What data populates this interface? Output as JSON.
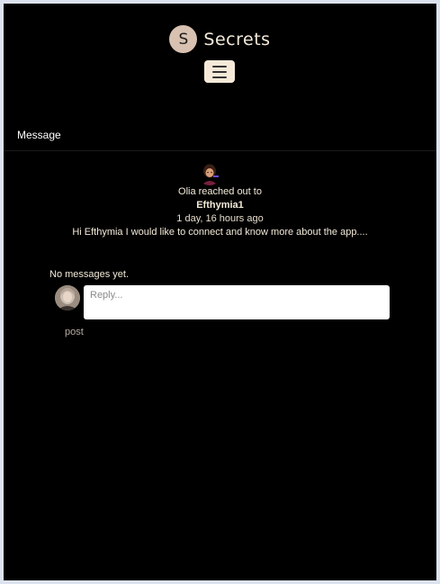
{
  "brand": {
    "logo_letter": "S",
    "name": "Secrets"
  },
  "header": {
    "menu_icon": "hamburger-icon"
  },
  "page": {
    "section_title": "Message"
  },
  "message": {
    "sender_avatar_icon": "user-avatar",
    "reached_out_text": "Olia reached out to",
    "recipient": "Efthymia1",
    "timestamp": "1 day, 16 hours ago",
    "body": "Hi Efthymia I would like to connect and know more about the app...."
  },
  "replies": {
    "empty_text": "No messages yet.",
    "input_placeholder": "Reply...",
    "post_label": "post",
    "avatar_icon": "user-avatar"
  },
  "colors": {
    "background": "#000000",
    "frame": "#dde3ee",
    "text": "#f3ead9",
    "accent": "#f5ead9"
  }
}
